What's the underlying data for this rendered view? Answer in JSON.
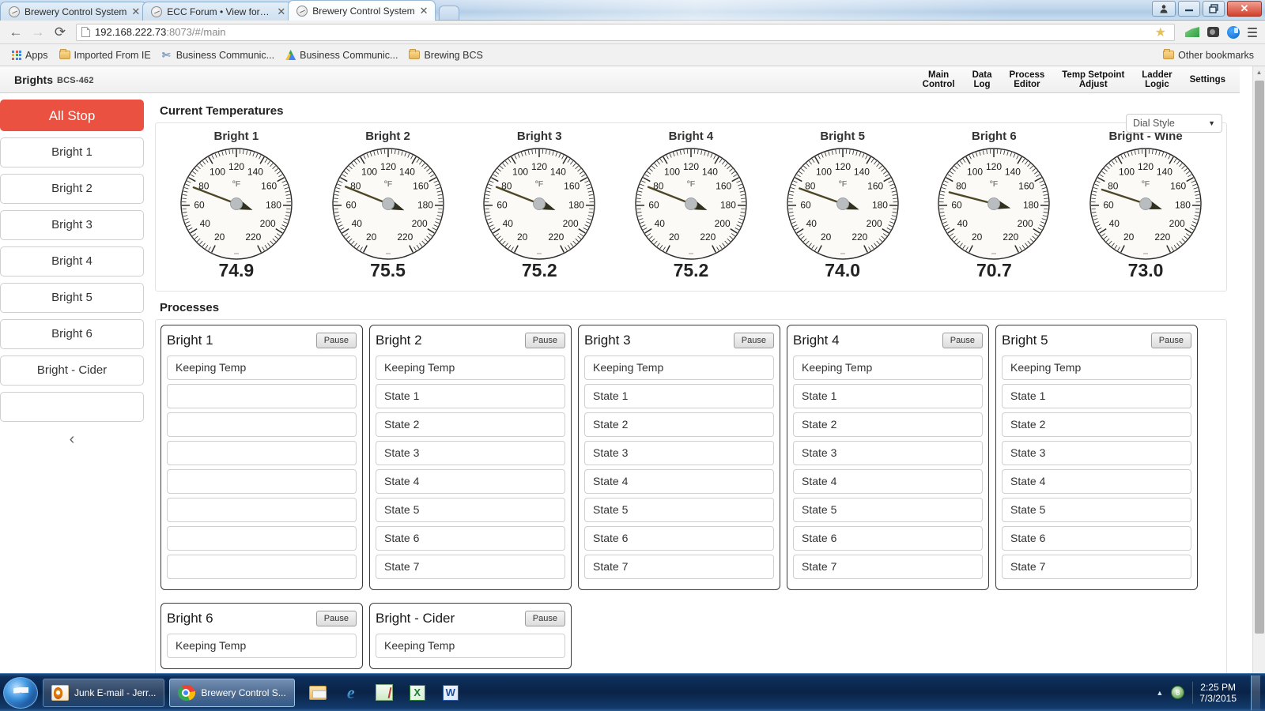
{
  "browser": {
    "tabs": [
      {
        "title": "Brewery Control System",
        "active": false
      },
      {
        "title": "ECC Forum • View forum -",
        "active": false
      },
      {
        "title": "Brewery Control System",
        "active": true
      }
    ],
    "close_glyph": "✕",
    "nav": {
      "back_glyph": "←",
      "forward_glyph": "→",
      "reload_glyph": "⟳"
    },
    "url_host": "192.168.222.73",
    "url_rest": ":8073/#/main",
    "star_glyph": "★",
    "window_controls": {
      "user": "👤",
      "minimize": "—",
      "restore": "❐",
      "close": "✕"
    },
    "bookmarks": [
      {
        "label": "Apps",
        "icon": "apps-grid-icon"
      },
      {
        "label": "Imported From IE",
        "icon": "folder-icon"
      },
      {
        "label": "Business Communic...",
        "icon": "scissors-icon"
      },
      {
        "label": "Business Communic...",
        "icon": "drive-icon"
      },
      {
        "label": "Brewing BCS",
        "icon": "folder-icon"
      }
    ],
    "other_bookmarks": "Other bookmarks"
  },
  "app": {
    "brand": "Brights",
    "model": "BCS-462",
    "topnav": [
      {
        "label": "Main\nControl"
      },
      {
        "label": "Data\nLog"
      },
      {
        "label": "Process\nEditor"
      },
      {
        "label": "Temp Setpoint\nAdjust"
      },
      {
        "label": "Ladder\nLogic"
      },
      {
        "label": "Settings"
      }
    ]
  },
  "sidebar": {
    "all_stop": "All Stop",
    "items": [
      {
        "label": "Bright 1"
      },
      {
        "label": "Bright 2"
      },
      {
        "label": "Bright 3"
      },
      {
        "label": "Bright 4"
      },
      {
        "label": "Bright 5"
      },
      {
        "label": "Bright 6"
      },
      {
        "label": "Bright - Cider"
      },
      {
        "label": ""
      }
    ],
    "collapse_glyph": "‹"
  },
  "temperatures": {
    "title": "Current Temperatures",
    "dial_style_label": "Dial Style",
    "dial_caret": "▼",
    "unit": "ºF",
    "scale_min": 20,
    "scale_max": 220,
    "tick_labels": [
      20,
      40,
      60,
      80,
      100,
      120,
      140,
      160,
      180,
      200,
      220
    ],
    "gauges": [
      {
        "name": "Bright 1",
        "value": "74.9",
        "numeric": 74.9
      },
      {
        "name": "Bright 2",
        "value": "75.5",
        "numeric": 75.5
      },
      {
        "name": "Bright 3",
        "value": "75.2",
        "numeric": 75.2
      },
      {
        "name": "Bright 4",
        "value": "75.2",
        "numeric": 75.2
      },
      {
        "name": "Bright 5",
        "value": "74.0",
        "numeric": 74.0
      },
      {
        "name": "Bright 6",
        "value": "70.7",
        "numeric": 70.7
      },
      {
        "name": "Bright - Wine",
        "value": "73.0",
        "numeric": 73.0
      }
    ]
  },
  "processes": {
    "title": "Processes",
    "pause_label": "Pause",
    "panels": [
      {
        "name": "Bright 1",
        "states": [
          "Keeping Temp",
          "",
          "",
          "",
          "",
          "",
          "",
          ""
        ]
      },
      {
        "name": "Bright 2",
        "states": [
          "Keeping Temp",
          "State 1",
          "State 2",
          "State 3",
          "State 4",
          "State 5",
          "State 6",
          "State 7"
        ]
      },
      {
        "name": "Bright 3",
        "states": [
          "Keeping Temp",
          "State 1",
          "State 2",
          "State 3",
          "State 4",
          "State 5",
          "State 6",
          "State 7"
        ]
      },
      {
        "name": "Bright 4",
        "states": [
          "Keeping Temp",
          "State 1",
          "State 2",
          "State 3",
          "State 4",
          "State 5",
          "State 6",
          "State 7"
        ]
      },
      {
        "name": "Bright 5",
        "states": [
          "Keeping Temp",
          "State 1",
          "State 2",
          "State 3",
          "State 4",
          "State 5",
          "State 6",
          "State 7"
        ]
      },
      {
        "name": "Bright 6",
        "states": [
          "Keeping Temp"
        ]
      },
      {
        "name": "Bright - Cider",
        "states": [
          "Keeping Temp"
        ]
      }
    ]
  },
  "taskbar": {
    "items": [
      {
        "label": "Junk E-mail - Jerr...",
        "icon": "outlook-icon",
        "active": false
      },
      {
        "label": "Brewery Control S...",
        "icon": "chrome-icon",
        "active": true
      }
    ],
    "quick": [
      "explorer-icon",
      "internet-explorer-icon",
      "notepad-icon",
      "excel-icon",
      "word-icon"
    ],
    "tray_arrow": "▲",
    "time": "2:25 PM",
    "date": "7/3/2015"
  },
  "colors": {
    "accent_red": "#ea5140",
    "needle": "#4d4726",
    "hub": "#b9bdc0",
    "taskbar_blue": "#0a2347"
  }
}
